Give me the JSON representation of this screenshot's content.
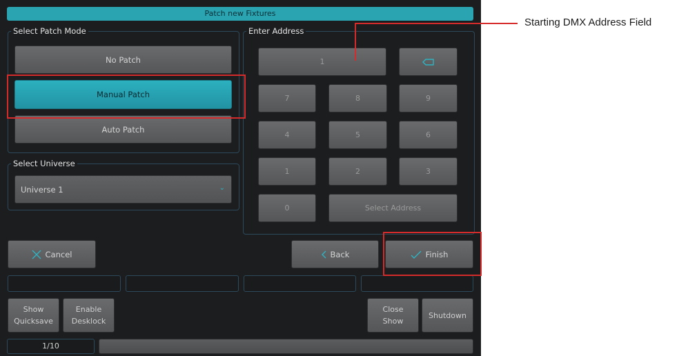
{
  "window": {
    "title": "Patch new Fixtures"
  },
  "patch_mode": {
    "label": "Select Patch Mode",
    "options": [
      "No Patch",
      "Manual Patch",
      "Auto Patch"
    ],
    "selected": "Manual Patch"
  },
  "universe": {
    "label": "Select Universe",
    "selected": "Universe 1"
  },
  "address": {
    "label": "Enter Address",
    "value": "1",
    "keypad": [
      "7",
      "8",
      "9",
      "4",
      "5",
      "6",
      "1",
      "2",
      "3",
      "0"
    ],
    "select_label": "Select Address"
  },
  "actions": {
    "cancel": "Cancel",
    "back": "Back",
    "finish": "Finish"
  },
  "bottom": {
    "show_quicksave": [
      "Show",
      "Quicksave"
    ],
    "enable_desklock": [
      "Enable",
      "Desklock"
    ],
    "close_show": [
      "Close",
      "Show"
    ],
    "shutdown": "Shutdown",
    "page": "1/10"
  },
  "annotation": {
    "callout": "Starting DMX Address Field",
    "color": "#d62b2b"
  },
  "colors": {
    "accent": "#2ba4b2",
    "panel_border": "#2c4a5b",
    "background": "#1c1d1f"
  }
}
